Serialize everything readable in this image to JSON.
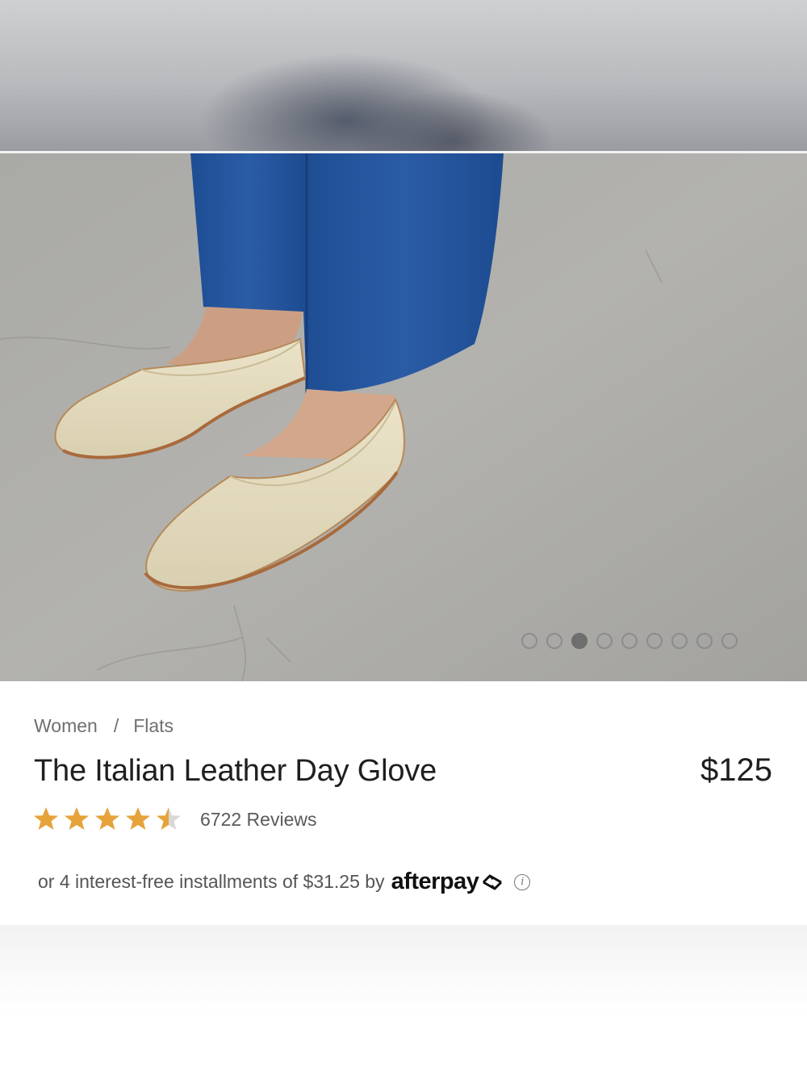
{
  "product": {
    "breadcrumb": [
      "Women",
      "Flats"
    ],
    "breadcrumb_separator": "/",
    "title": "The Italian Leather Day Glove",
    "price": "$125",
    "rating": 4.5,
    "rating_max": 5,
    "reviews_label": "6722 Reviews",
    "star_color": "#e6a33a"
  },
  "gallery": {
    "image_icon": "product-photo-flats-on-concrete",
    "dot_count": 9,
    "active_index": 2
  },
  "afterpay": {
    "text": "or 4 interest-free installments of $31.25 by",
    "brand": "afterpay",
    "info_icon": "info-icon",
    "info_glyph": "i"
  }
}
